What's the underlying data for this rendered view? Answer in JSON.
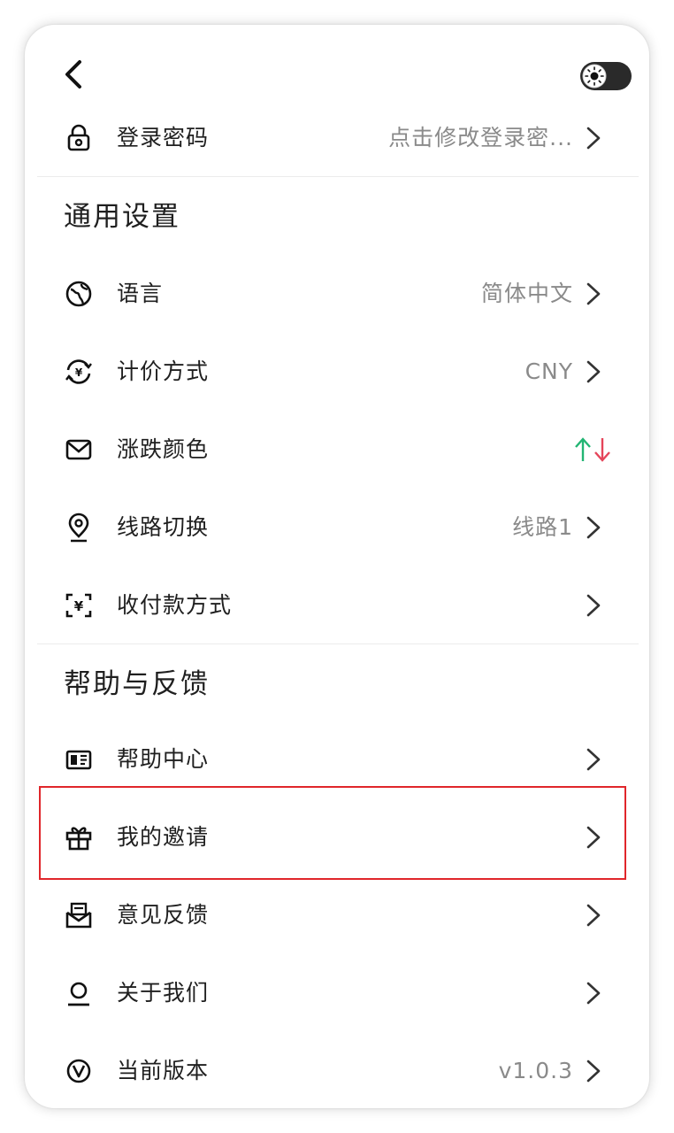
{
  "colors": {
    "text": "#1f1f1f",
    "secondary": "#8a8a8a",
    "up": "#22b573",
    "down": "#e5455a",
    "highlight": "#e0262b"
  },
  "header": {
    "back_icon": "chevron-left-icon",
    "theme_toggle_icon": "sun-icon"
  },
  "security": {
    "login_password": {
      "label": "登录密码",
      "value": "点击修改登录密...",
      "icon": "lock-icon"
    }
  },
  "general": {
    "title": "通用设置",
    "items": [
      {
        "label": "语言",
        "value": "简体中文",
        "icon": "globe-icon"
      },
      {
        "label": "计价方式",
        "value": "CNY",
        "icon": "currency-exchange-icon"
      },
      {
        "label": "涨跌颜色",
        "value": "",
        "icon": "mail-icon",
        "up_symbol": "↑",
        "down_symbol": "↓"
      },
      {
        "label": "线路切换",
        "value": "线路1",
        "icon": "location-pin-icon"
      },
      {
        "label": "收付款方式",
        "value": "",
        "icon": "payment-scan-icon"
      }
    ]
  },
  "help": {
    "title": "帮助与反馈",
    "items": [
      {
        "label": "帮助中心",
        "value": "",
        "icon": "book-icon"
      },
      {
        "label": "我的邀请",
        "value": "",
        "icon": "gift-icon"
      },
      {
        "label": "意见反馈",
        "value": "",
        "icon": "feedback-envelope-icon"
      },
      {
        "label": "关于我们",
        "value": "",
        "icon": "info-person-icon"
      },
      {
        "label": "当前版本",
        "value": "v1.0.3",
        "icon": "version-v-icon"
      }
    ]
  }
}
